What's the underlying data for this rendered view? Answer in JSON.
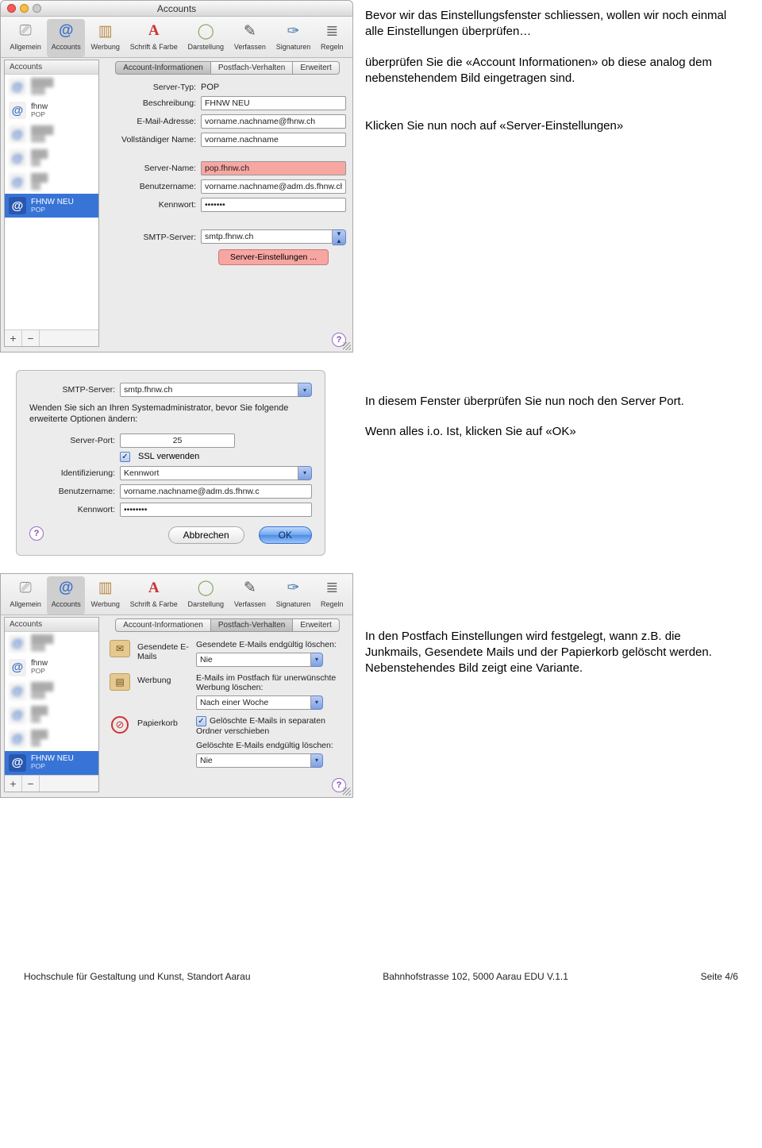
{
  "window_title": "Accounts",
  "toolbar": {
    "items": [
      "Allgemein",
      "Accounts",
      "Werbung",
      "Schrift & Farbe",
      "Darstellung",
      "Verfassen",
      "Signaturen",
      "Regeln"
    ],
    "selected_index": 1
  },
  "sidebar": {
    "header": "Accounts",
    "plus": "+",
    "minus": "−",
    "items": [
      {
        "name": "",
        "sub": "",
        "icon": "at"
      },
      {
        "name": "fhnw",
        "sub": "POP",
        "icon": "at"
      },
      {
        "name": "",
        "sub": "",
        "icon": "at"
      },
      {
        "name": "",
        "sub": "",
        "icon": "at"
      },
      {
        "name": "",
        "sub": "",
        "icon": "at"
      },
      {
        "name": "FHNW NEU",
        "sub": "POP",
        "icon": "at",
        "selected": true
      }
    ]
  },
  "tabs1": [
    "Account-Informationen",
    "Postfach-Verhalten",
    "Erweitert"
  ],
  "tabs1_sel": 0,
  "info": {
    "server_typ_lab": "Server-Typ:",
    "server_typ": "POP",
    "beschr_lab": "Beschreibung:",
    "beschr": "FHNW NEU",
    "email_lab": "E-Mail-Adresse:",
    "email": "vorname.nachname@fhnw.ch",
    "voll_lab": "Vollständiger Name:",
    "voll": "vorname.nachname",
    "srvname_lab": "Server-Name:",
    "srvname": "pop.fhnw.ch",
    "benutzer_lab": "Benutzername:",
    "benutzer": "vorname.nachname@adm.ds.fhnw.ch",
    "kennwort_lab": "Kennwort:",
    "kennwort": "•••••••",
    "smtp_lab": "SMTP-Server:",
    "smtp": "smtp.fhnw.ch",
    "srv_settings_btn": "Server-Einstellungen ..."
  },
  "sheet": {
    "smtp_lab": "SMTP-Server:",
    "smtp": "smtp.fhnw.ch",
    "note": "Wenden Sie sich an Ihren Systemadministrator, bevor Sie folgende erweiterte Optionen ändern:",
    "port_lab": "Server-Port:",
    "port": "25",
    "ssl": "SSL verwenden",
    "ident_lab": "Identifizierung:",
    "ident": "Kennwort",
    "user_lab": "Benutzername:",
    "user": "vorname.nachname@adm.ds.fhnw.c",
    "pw_lab": "Kennwort:",
    "pw": "••••••••",
    "cancel": "Abbrechen",
    "ok": "OK"
  },
  "tabs3_sel": 1,
  "mb": {
    "sent_lab": "Gesendete E-Mails",
    "sent_txt": "Gesendete E-Mails endgültig löschen:",
    "sent_sel": "Nie",
    "junk_lab": "Werbung",
    "junk_txt": "E-Mails im Postfach für unerwünschte Werbung löschen:",
    "junk_sel": "Nach einer Woche",
    "trash_lab": "Papierkorb",
    "trash_chk": "Gelöschte E-Mails in separaten Ordner verschieben",
    "trash_txt": "Gelöschte E-Mails endgültig löschen:",
    "trash_sel": "Nie"
  },
  "intro": {
    "p1": "Bevor wir das Einstellungsfenster schliessen, wollen wir noch einmal alle Einstellungen überprüfen…",
    "p2": "überprüfen Sie die «Account Informationen» ob diese analog dem nebenstehendem Bild eingetragen sind.",
    "p3": "Klicken Sie nun noch auf «Server-Einstellungen»"
  },
  "mid": {
    "p1": "In diesem Fenster überprüfen Sie nun noch den Server Port.",
    "p2": "Wenn alles i.o. Ist, klicken Sie auf «OK»"
  },
  "low": {
    "p1": "In den Postfach Einstellungen wird festgelegt, wann z.B. die Junkmails, Gesendete Mails und der Papierkorb gelöscht werden. Nebenstehendes Bild zeigt eine Variante."
  },
  "footer": {
    "left": "Hochschule für Gestaltung und Kunst, Standort Aarau",
    "mid": "Bahnhofstrasse 102, 5000 Aarau   EDU   V.1.1",
    "right": "Seite 4/6"
  },
  "help": "?",
  "caret": "▾",
  "check": "✓"
}
